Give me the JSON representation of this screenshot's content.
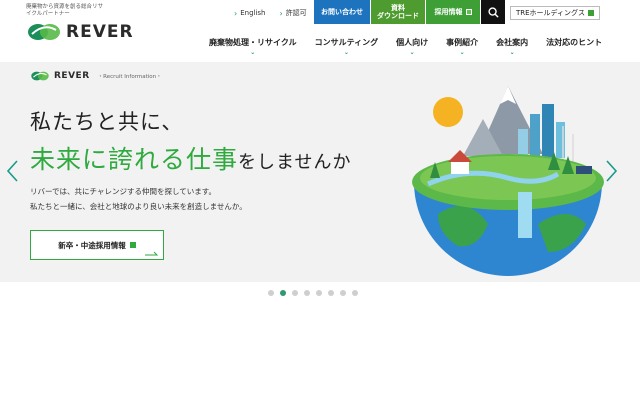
{
  "header": {
    "tagline": "廃棄物から資源を創る総合リサイクルパートナー",
    "logo_text": "REVER",
    "util_links": [
      {
        "label": "English"
      },
      {
        "label": "許認可"
      }
    ],
    "buttons": {
      "contact": "お問い合わせ",
      "download_line1": "資料",
      "download_line2": "ダウンロード",
      "recruit": "採用情報",
      "search_icon": "search-icon"
    },
    "tre_link": "TREホールディングス",
    "nav": [
      {
        "label": "廃棄物処理・リサイクル"
      },
      {
        "label": "コンサルティング"
      },
      {
        "label": "個人向け"
      },
      {
        "label": "事例紹介"
      },
      {
        "label": "会社案内"
      },
      {
        "label": "法対応のヒント"
      }
    ]
  },
  "hero": {
    "logo_text": "REVER",
    "tag_info": "・Recruit Information・",
    "line1": "私たちと共に、",
    "line2_green": "未来に誇れる仕事",
    "line2_dark": "をしませんか",
    "sub1": "リバーでは、共にチャレンジする仲間を探しています。",
    "sub2": "私たちと一緒に、会社と地球のより良い未来を創造しませんか。",
    "cta_label": "新卒・中途採用情報"
  },
  "carousel": {
    "total_slides": 8,
    "active_index": 1
  },
  "colors": {
    "brand_green": "#2eaa3f",
    "contact_blue": "#1e73be",
    "download_green": "#4e9b2f",
    "recruit_green": "#3e9f36",
    "search_black": "#111111",
    "hero_bg": "#f2f2f2",
    "dot_active": "#2e9a6e"
  }
}
